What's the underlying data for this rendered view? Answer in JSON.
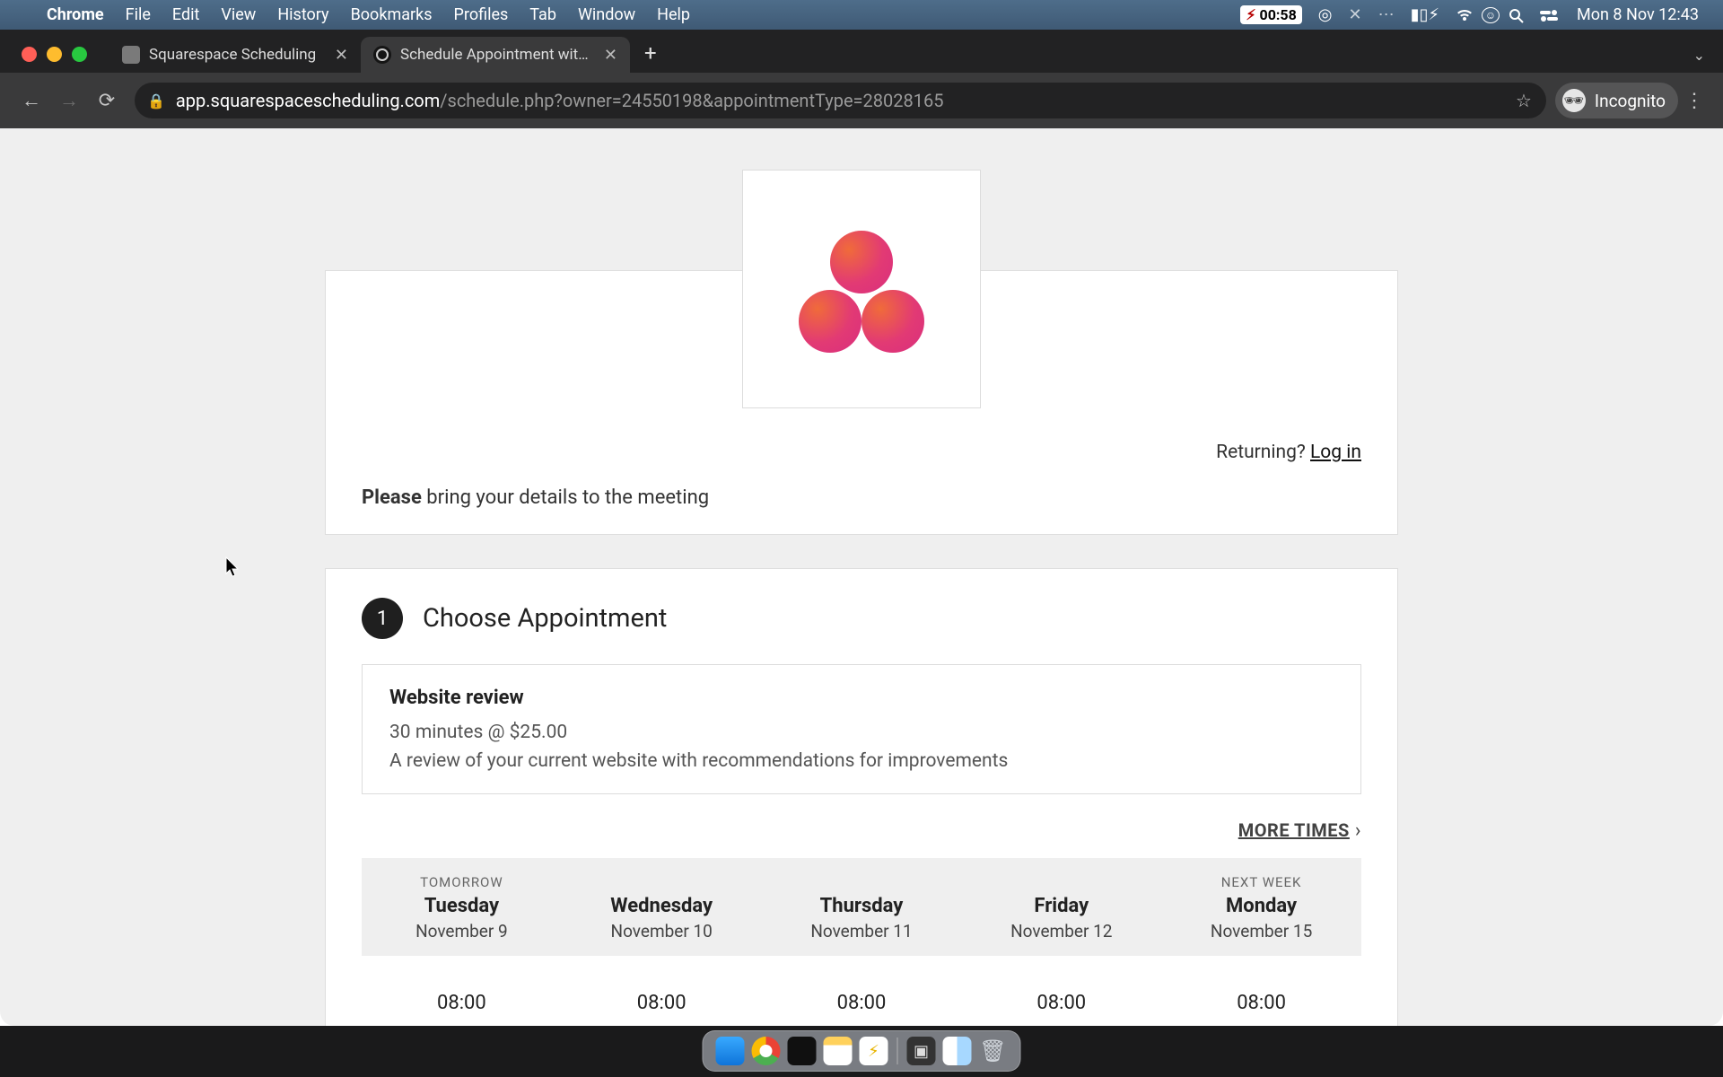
{
  "menubar": {
    "app": "Chrome",
    "items": [
      "File",
      "Edit",
      "View",
      "History",
      "Bookmarks",
      "Profiles",
      "Tab",
      "Window",
      "Help"
    ],
    "battery_time": "00:58",
    "clock": "Mon 8 Nov  12:43"
  },
  "browser": {
    "tabs": [
      {
        "title": "Squarespace Scheduling",
        "active": false
      },
      {
        "title": "Schedule Appointment with UI",
        "active": true
      }
    ],
    "url_host": "app.squarespacescheduling.com",
    "url_path": "/schedule.php?owner=24550198&appointmentType=28028165",
    "mode_label": "Incognito"
  },
  "page": {
    "returning_text": "Returning? ",
    "login_text": "Log in",
    "note_bold": "Please",
    "note_rest": " bring your details to the meeting",
    "step_number": "1",
    "step_title": "Choose Appointment",
    "appointment": {
      "name": "Website review",
      "meta": "30 minutes @ $25.00",
      "desc": "A review of your current website with recommendations for improvements"
    },
    "more_times_label": "MORE TIMES",
    "days": [
      {
        "tag": "TOMORROW",
        "dow": "Tuesday",
        "date": "November 9"
      },
      {
        "tag": "",
        "dow": "Wednesday",
        "date": "November 10"
      },
      {
        "tag": "",
        "dow": "Thursday",
        "date": "November 11"
      },
      {
        "tag": "",
        "dow": "Friday",
        "date": "November 12"
      },
      {
        "tag": "NEXT WEEK",
        "dow": "Monday",
        "date": "November 15"
      }
    ],
    "times_row": [
      "08:00",
      "08:00",
      "08:00",
      "08:00",
      "08:00"
    ]
  },
  "dock": {
    "apps": [
      "finder",
      "chrome",
      "terminal",
      "notes",
      "bolt",
      "camera",
      "minimized",
      "trash"
    ]
  }
}
